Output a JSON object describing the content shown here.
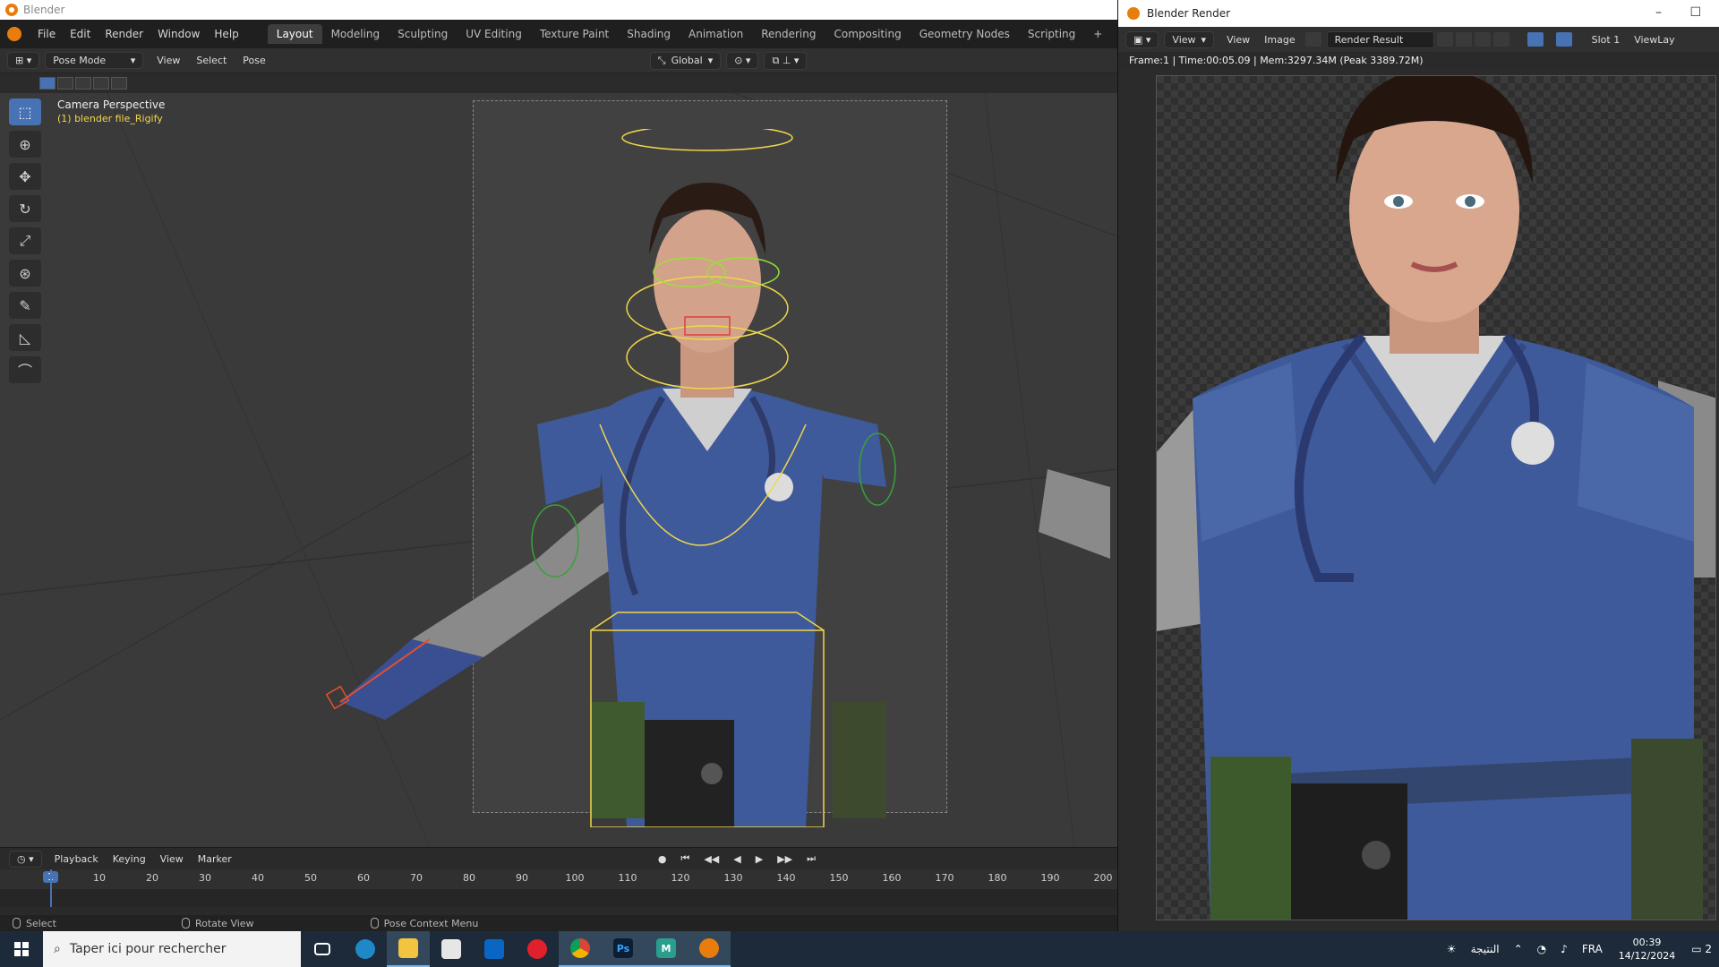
{
  "main_window": {
    "title": "Blender",
    "menus": [
      "File",
      "Edit",
      "Render",
      "Window",
      "Help"
    ],
    "workspaces": [
      "Layout",
      "Modeling",
      "Sculpting",
      "UV Editing",
      "Texture Paint",
      "Shading",
      "Animation",
      "Rendering",
      "Compositing",
      "Geometry Nodes",
      "Scripting"
    ],
    "active_workspace": "Layout",
    "add_workspace_label": "+",
    "mode": "Pose Mode",
    "header_menus": [
      "View",
      "Select",
      "Pose"
    ],
    "orientation": "Global"
  },
  "viewport": {
    "view_label": "Camera Perspective",
    "object_label": "(1) blender file_Rigify",
    "tools": [
      "select-box-icon",
      "cursor-icon",
      "move-icon",
      "rotate-icon",
      "scale-icon",
      "transform-icon",
      "annotate-icon",
      "measure-icon",
      "pose-relax-icon"
    ]
  },
  "timeline": {
    "menus": [
      "Playback",
      "Keying",
      "View",
      "Marker"
    ],
    "current_frame": "1",
    "ticks": [
      "10",
      "20",
      "30",
      "40",
      "50",
      "60",
      "70",
      "80",
      "90",
      "100",
      "110",
      "120",
      "130",
      "140",
      "150",
      "160",
      "170",
      "180",
      "190",
      "200"
    ]
  },
  "statusbar": {
    "items": [
      "Select",
      "Rotate View",
      "Pose Context Menu"
    ]
  },
  "render_window": {
    "title": "Blender Render",
    "header": {
      "view_menu": "View",
      "menus": [
        "View",
        "Image"
      ],
      "image_name": "Render Result",
      "slot": "Slot 1",
      "view_layer": "ViewLay"
    },
    "info": "Frame:1 | Time:00:05.09 | Mem:3297.34M (Peak 3389.72M)",
    "minimize_glyph": "–",
    "maximize_glyph": "☐"
  },
  "taskbar": {
    "search_placeholder": "Taper ici pour rechercher",
    "apps": [
      "task-view",
      "edge",
      "file-explorer",
      "store",
      "outlook",
      "opera",
      "chrome",
      "photoshop",
      "m-app",
      "blender"
    ],
    "photoshop_label": "Ps",
    "m_label": "M",
    "weather_label": "النتيجة",
    "language": "FRA",
    "time": "00:39",
    "date": "14/12/2024",
    "notification_count": "2"
  },
  "colors": {
    "accent": "#4772b3",
    "blender_orange": "#e87d0d",
    "rig_yellow": "#f0d84a",
    "scrubs_blue": "#3f5a9a"
  }
}
